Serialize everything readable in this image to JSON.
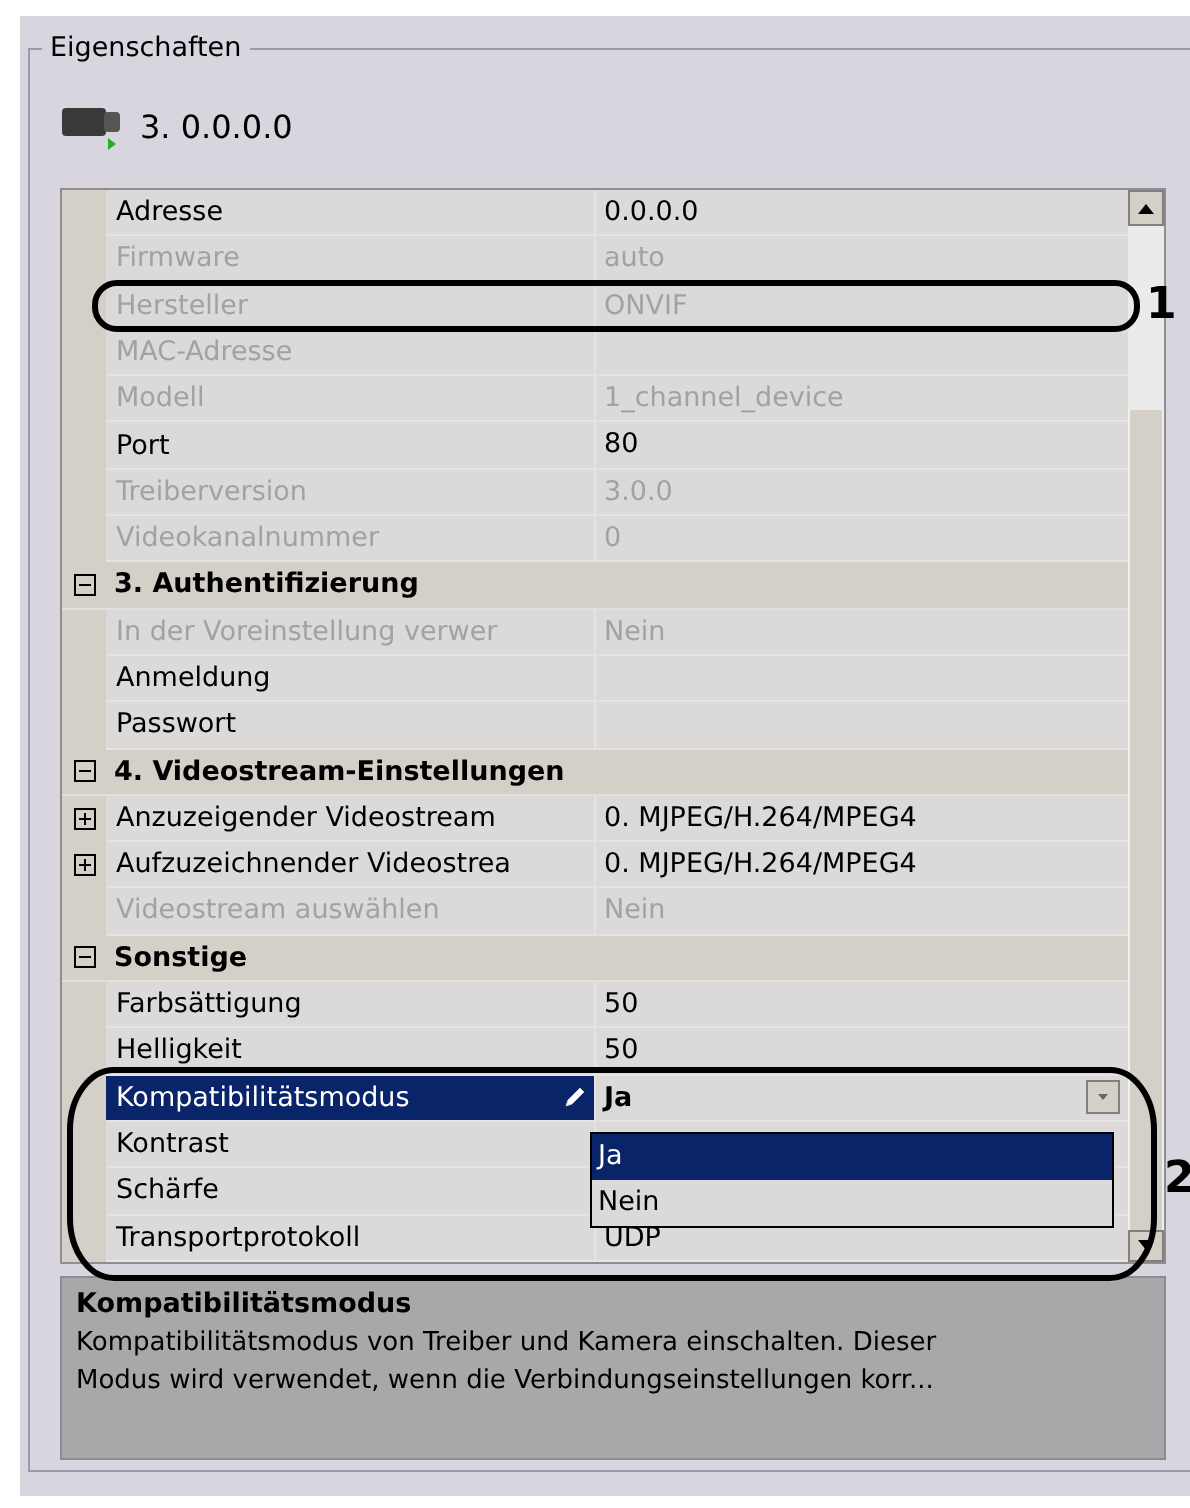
{
  "panel": {
    "title": "Eigenschaften"
  },
  "device": {
    "label": "3. 0.0.0.0"
  },
  "rows": [
    {
      "kind": "property",
      "name": "Adresse",
      "value": "0.0.0.0",
      "disabled": false,
      "selected": false
    },
    {
      "kind": "property",
      "name": "Firmware",
      "value": "auto",
      "disabled": true,
      "selected": false
    },
    {
      "kind": "property",
      "name": "Hersteller",
      "value": "ONVIF",
      "disabled": true,
      "selected": false
    },
    {
      "kind": "property",
      "name": "MAC-Adresse",
      "disabled": true,
      "selected": false
    },
    {
      "kind": "property",
      "name": "Modell",
      "value": "1_channel_device",
      "disabled": true,
      "selected": false
    },
    {
      "kind": "property",
      "name": "Port",
      "value": "80",
      "disabled": false,
      "selected": false
    },
    {
      "kind": "property",
      "name": "Treiberversion",
      "value": "3.0.0",
      "disabled": true,
      "selected": false
    },
    {
      "kind": "property",
      "name": "Videokanalnummer",
      "value": "0",
      "disabled": true,
      "selected": false
    },
    {
      "kind": "category",
      "name": "3. Authentifizierung",
      "expanded": true
    },
    {
      "kind": "property",
      "name": "In der Voreinstellung verwer",
      "value": "Nein",
      "disabled": true,
      "selected": false
    },
    {
      "kind": "property",
      "name": "Anmeldung",
      "disabled": false,
      "selected": false
    },
    {
      "kind": "property",
      "name": "Passwort",
      "disabled": false,
      "selected": false
    },
    {
      "kind": "category",
      "name": "4. Videostream-Einstellungen",
      "expanded": true
    },
    {
      "kind": "property",
      "name": "Anzuzeigender Videostream",
      "value": "0. MJPEG/H.264/MPEG4",
      "disabled": false,
      "selected": false,
      "expanded": false
    },
    {
      "kind": "property",
      "name": "Aufzuzeichnender Videostrea",
      "value": "0. MJPEG/H.264/MPEG4",
      "disabled": false,
      "selected": false,
      "expanded": false
    },
    {
      "kind": "property",
      "name": "Videostream auswählen",
      "value": "Nein",
      "disabled": true,
      "selected": false
    },
    {
      "kind": "category",
      "name": "Sonstige",
      "expanded": true
    },
    {
      "kind": "property",
      "name": "Farbsättigung",
      "value": "50",
      "disabled": false,
      "selected": false
    },
    {
      "kind": "property",
      "name": "Helligkeit",
      "value": "50",
      "disabled": false,
      "selected": false
    },
    {
      "kind": "property",
      "name": "Kompatibilitätsmodus",
      "value": "Ja",
      "disabled": false,
      "selected": true
    },
    {
      "kind": "property",
      "name": "Kontrast",
      "disabled": false,
      "selected": false
    },
    {
      "kind": "property",
      "name": "Schärfe",
      "disabled": false,
      "selected": false
    },
    {
      "kind": "property",
      "name": "Transportprotokoll",
      "value": "UDP",
      "disabled": false,
      "selected": false
    }
  ],
  "dropdown": {
    "open": true,
    "options": [
      {
        "label": "Ja",
        "selected": true
      },
      {
        "label": "Nein",
        "selected": false
      }
    ]
  },
  "description": {
    "title": "Kompatibilitätsmodus",
    "lines": [
      "Kompatibilitätsmodus von Treiber und Kamera einschalten. Dieser",
      "Modus wird verwendet, wenn die Verbindungseinstellungen korr..."
    ]
  },
  "annotations": [
    {
      "label": "1"
    },
    {
      "label": "2"
    }
  ]
}
